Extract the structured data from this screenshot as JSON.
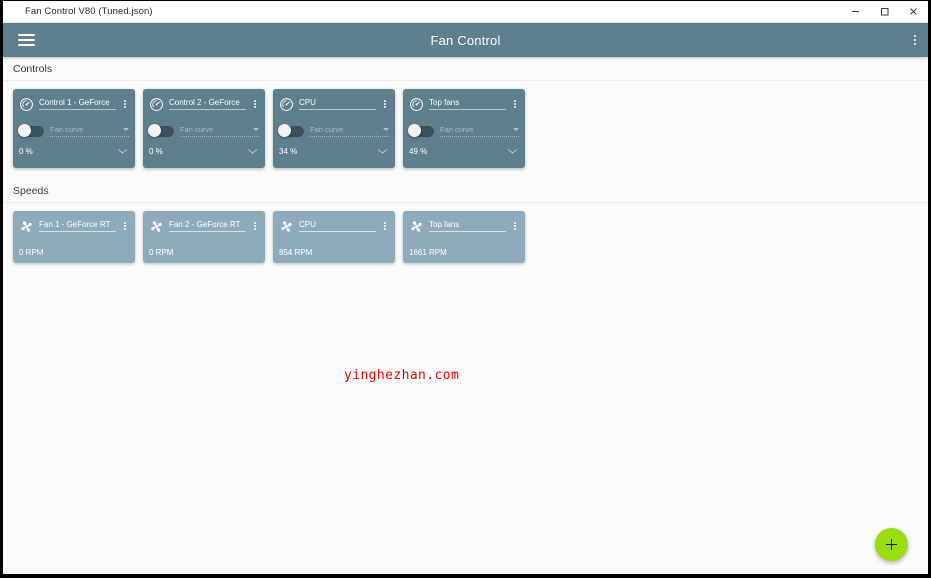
{
  "window": {
    "title": "Fan Control V80 (Tuned.json)",
    "controls": {
      "minimize": "minimize-button",
      "maximize": "maximize-button",
      "close": "close-button"
    }
  },
  "appbar": {
    "menu_icon": "hamburger-icon",
    "title": "Fan Control",
    "overflow_icon": "kebab-menu-icon"
  },
  "sections": [
    {
      "header": "Controls",
      "type": "controls",
      "cards": [
        {
          "icon": "gauge-icon",
          "title": "Control 1 - GeForce",
          "toggle_state": "off",
          "curve_placeholder": "Fan curve",
          "value": "0 %",
          "overflow_icon": "kebab-menu-icon"
        },
        {
          "icon": "gauge-icon",
          "title": "Control 2 - GeForce",
          "toggle_state": "off",
          "curve_placeholder": "Fan curve",
          "value": "0 %",
          "overflow_icon": "kebab-menu-icon"
        },
        {
          "icon": "gauge-icon",
          "title": "CPU",
          "toggle_state": "off",
          "curve_placeholder": "Fan curve",
          "value": "34 %",
          "overflow_icon": "kebab-menu-icon"
        },
        {
          "icon": "gauge-icon",
          "title": "Top fans",
          "toggle_state": "off",
          "curve_placeholder": "Fan curve",
          "value": "49 %",
          "overflow_icon": "kebab-menu-icon"
        }
      ]
    },
    {
      "header": "Speeds",
      "type": "speeds",
      "cards": [
        {
          "icon": "fan-icon",
          "title": "Fan 1 - GeForce RT",
          "value": "0 RPM",
          "overflow_icon": "kebab-menu-icon"
        },
        {
          "icon": "fan-icon",
          "title": "Fan 2 - GeForce RT",
          "value": "0 RPM",
          "overflow_icon": "kebab-menu-icon"
        },
        {
          "icon": "fan-icon",
          "title": "CPU",
          "value": "854 RPM",
          "overflow_icon": "kebab-menu-icon"
        },
        {
          "icon": "fan-icon",
          "title": "Top fans",
          "value": "1661 RPM",
          "overflow_icon": "kebab-menu-icon"
        }
      ]
    }
  ],
  "watermark": {
    "text": "yinghezhan.com",
    "color": "#ee0000"
  },
  "fab": {
    "icon": "plus-icon",
    "color": "#9bdd11"
  },
  "theme": {
    "appbar": "#5e7f8c",
    "control_card": "#5e7f8c",
    "speed_card": "#8dabba",
    "content_bg": "#fbfbfb",
    "accent": "#9bdd11"
  }
}
